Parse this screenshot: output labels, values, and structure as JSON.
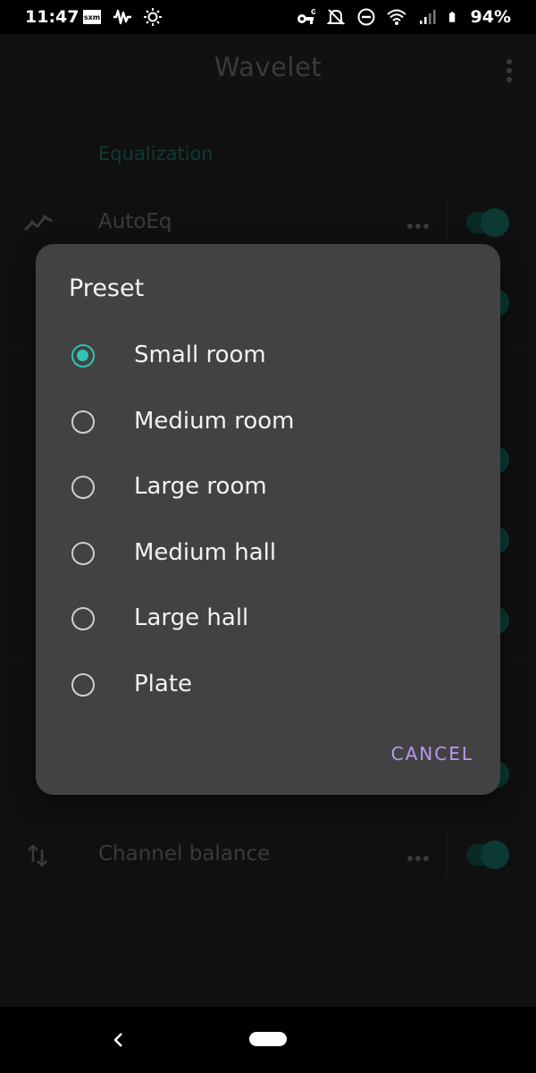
{
  "status_bar": {
    "time": "11:47",
    "battery": "94%",
    "left_icons": [
      "sxm-icon",
      "waveform-icon",
      "brightness-icon"
    ],
    "right_icons": [
      "vpn-key-icon",
      "bell-off-icon",
      "dnd-icon",
      "wifi-icon",
      "signal-icon",
      "battery-icon"
    ]
  },
  "app_bar": {
    "title": "Wavelet"
  },
  "background": {
    "section_header": "Equalization",
    "rows": [
      {
        "label": "AutoEq",
        "icon": "autoeq-icon"
      },
      {
        "label": "Channel balance",
        "icon": "balance-arrows-icon"
      }
    ]
  },
  "dialog": {
    "title": "Preset",
    "options": [
      {
        "label": "Small room",
        "selected": true
      },
      {
        "label": "Medium room",
        "selected": false
      },
      {
        "label": "Large room",
        "selected": false
      },
      {
        "label": "Medium hall",
        "selected": false
      },
      {
        "label": "Large hall",
        "selected": false
      },
      {
        "label": "Plate",
        "selected": false
      }
    ],
    "cancel_label": "CANCEL"
  },
  "colors": {
    "accent": "#2ec4b6",
    "dialog_bg": "#424242",
    "button": "#b99af0"
  }
}
